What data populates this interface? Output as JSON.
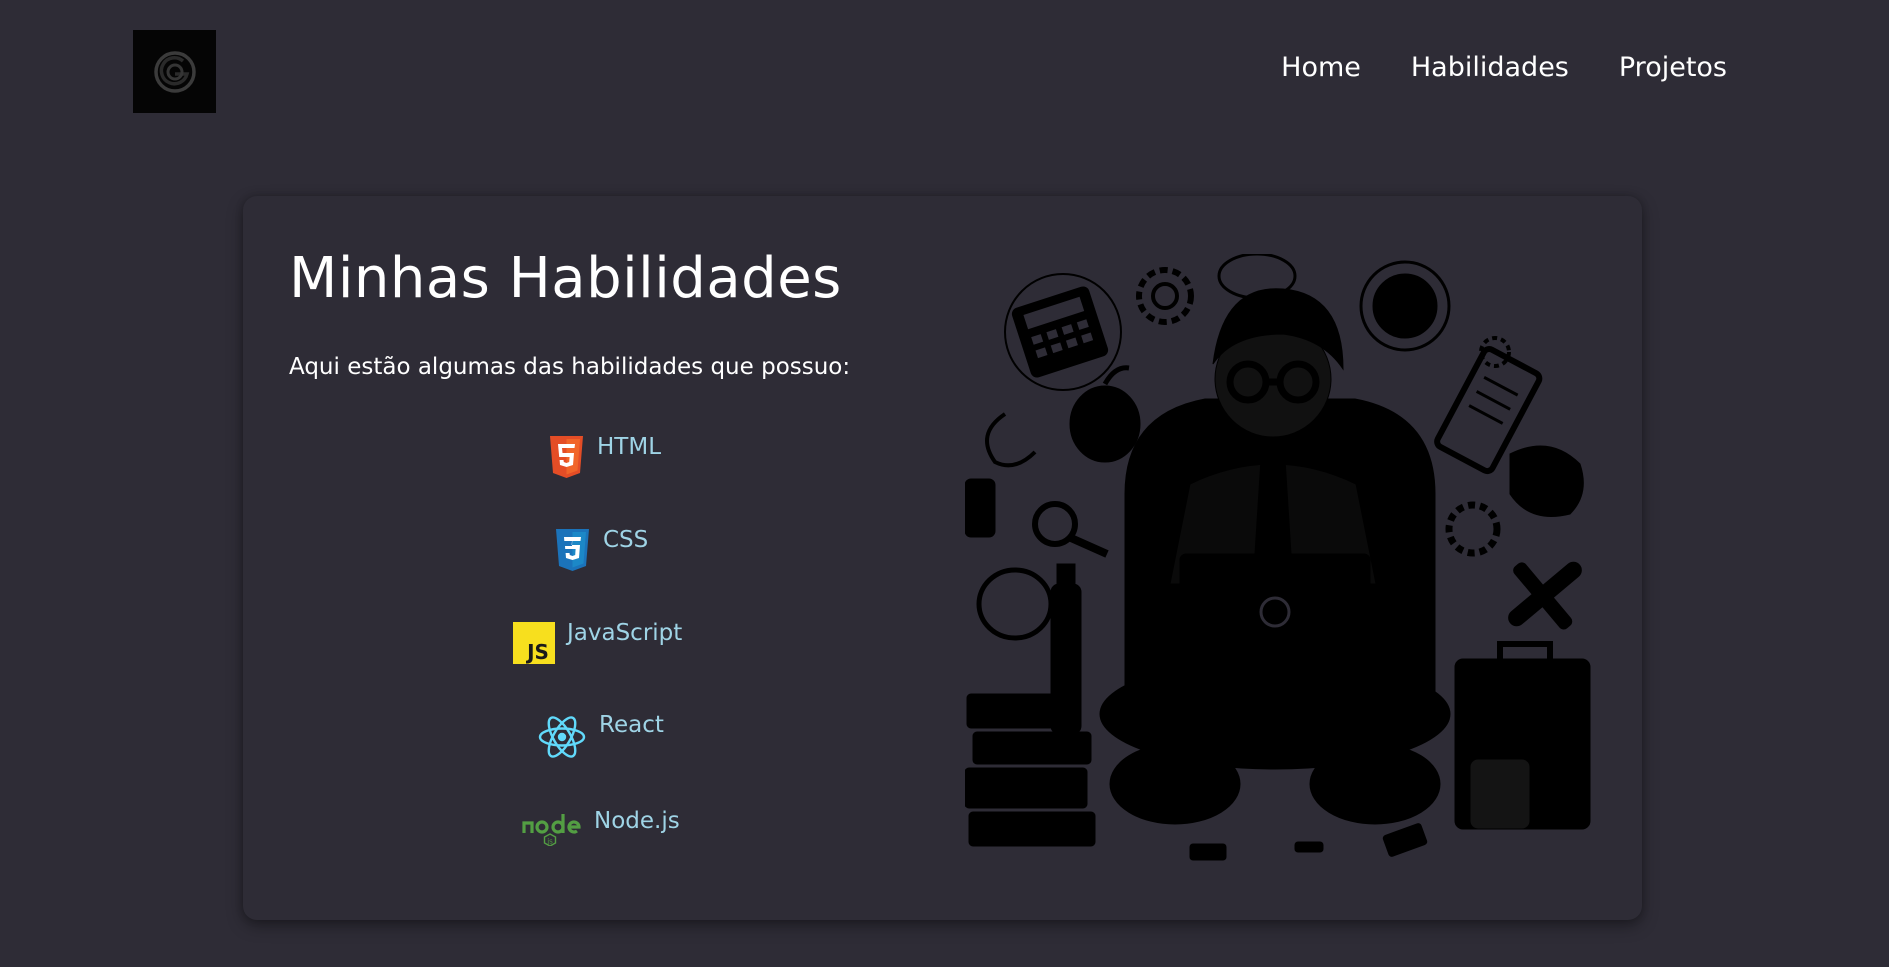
{
  "nav": {
    "items": [
      {
        "label": "Home"
      },
      {
        "label": "Habilidades"
      },
      {
        "label": "Projetos"
      }
    ]
  },
  "logo": {
    "icon": "logo-icon"
  },
  "main": {
    "title": "Minhas Habilidades",
    "subtitle": "Aqui estão algumas das habilidades que possuo:",
    "skills": [
      {
        "label": "HTML",
        "icon": "html5-icon",
        "color": "#e44d26"
      },
      {
        "label": "CSS",
        "icon": "css3-icon",
        "color": "#1b73ba"
      },
      {
        "label": "JavaScript",
        "icon": "javascript-icon",
        "color": "#f7df1e"
      },
      {
        "label": "React",
        "icon": "react-icon",
        "color": "#61dafb"
      },
      {
        "label": "Node.js",
        "icon": "nodejs-icon",
        "color": "#539e43"
      }
    ]
  },
  "illustration": {
    "icon": "developer-illustration"
  },
  "colors": {
    "background": "#2e2c36",
    "skill_text": "#9fd4e6"
  }
}
